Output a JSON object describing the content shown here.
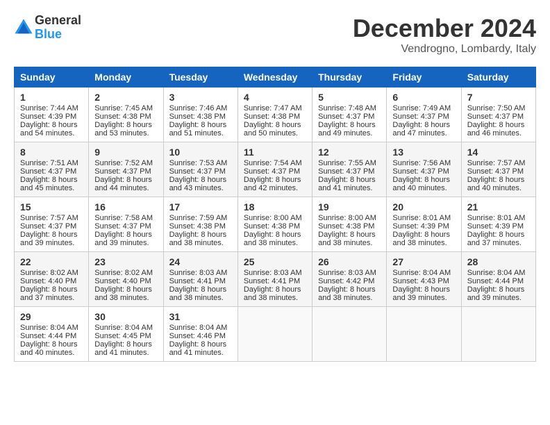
{
  "logo": {
    "general": "General",
    "blue": "Blue"
  },
  "title": "December 2024",
  "location": "Vendrogno, Lombardy, Italy",
  "days_of_week": [
    "Sunday",
    "Monday",
    "Tuesday",
    "Wednesday",
    "Thursday",
    "Friday",
    "Saturday"
  ],
  "weeks": [
    [
      {
        "day": "1",
        "sunrise": "Sunrise: 7:44 AM",
        "sunset": "Sunset: 4:39 PM",
        "daylight": "Daylight: 8 hours and 54 minutes."
      },
      {
        "day": "2",
        "sunrise": "Sunrise: 7:45 AM",
        "sunset": "Sunset: 4:38 PM",
        "daylight": "Daylight: 8 hours and 53 minutes."
      },
      {
        "day": "3",
        "sunrise": "Sunrise: 7:46 AM",
        "sunset": "Sunset: 4:38 PM",
        "daylight": "Daylight: 8 hours and 51 minutes."
      },
      {
        "day": "4",
        "sunrise": "Sunrise: 7:47 AM",
        "sunset": "Sunset: 4:38 PM",
        "daylight": "Daylight: 8 hours and 50 minutes."
      },
      {
        "day": "5",
        "sunrise": "Sunrise: 7:48 AM",
        "sunset": "Sunset: 4:37 PM",
        "daylight": "Daylight: 8 hours and 49 minutes."
      },
      {
        "day": "6",
        "sunrise": "Sunrise: 7:49 AM",
        "sunset": "Sunset: 4:37 PM",
        "daylight": "Daylight: 8 hours and 47 minutes."
      },
      {
        "day": "7",
        "sunrise": "Sunrise: 7:50 AM",
        "sunset": "Sunset: 4:37 PM",
        "daylight": "Daylight: 8 hours and 46 minutes."
      }
    ],
    [
      {
        "day": "8",
        "sunrise": "Sunrise: 7:51 AM",
        "sunset": "Sunset: 4:37 PM",
        "daylight": "Daylight: 8 hours and 45 minutes."
      },
      {
        "day": "9",
        "sunrise": "Sunrise: 7:52 AM",
        "sunset": "Sunset: 4:37 PM",
        "daylight": "Daylight: 8 hours and 44 minutes."
      },
      {
        "day": "10",
        "sunrise": "Sunrise: 7:53 AM",
        "sunset": "Sunset: 4:37 PM",
        "daylight": "Daylight: 8 hours and 43 minutes."
      },
      {
        "day": "11",
        "sunrise": "Sunrise: 7:54 AM",
        "sunset": "Sunset: 4:37 PM",
        "daylight": "Daylight: 8 hours and 42 minutes."
      },
      {
        "day": "12",
        "sunrise": "Sunrise: 7:55 AM",
        "sunset": "Sunset: 4:37 PM",
        "daylight": "Daylight: 8 hours and 41 minutes."
      },
      {
        "day": "13",
        "sunrise": "Sunrise: 7:56 AM",
        "sunset": "Sunset: 4:37 PM",
        "daylight": "Daylight: 8 hours and 40 minutes."
      },
      {
        "day": "14",
        "sunrise": "Sunrise: 7:57 AM",
        "sunset": "Sunset: 4:37 PM",
        "daylight": "Daylight: 8 hours and 40 minutes."
      }
    ],
    [
      {
        "day": "15",
        "sunrise": "Sunrise: 7:57 AM",
        "sunset": "Sunset: 4:37 PM",
        "daylight": "Daylight: 8 hours and 39 minutes."
      },
      {
        "day": "16",
        "sunrise": "Sunrise: 7:58 AM",
        "sunset": "Sunset: 4:37 PM",
        "daylight": "Daylight: 8 hours and 39 minutes."
      },
      {
        "day": "17",
        "sunrise": "Sunrise: 7:59 AM",
        "sunset": "Sunset: 4:38 PM",
        "daylight": "Daylight: 8 hours and 38 minutes."
      },
      {
        "day": "18",
        "sunrise": "Sunrise: 8:00 AM",
        "sunset": "Sunset: 4:38 PM",
        "daylight": "Daylight: 8 hours and 38 minutes."
      },
      {
        "day": "19",
        "sunrise": "Sunrise: 8:00 AM",
        "sunset": "Sunset: 4:38 PM",
        "daylight": "Daylight: 8 hours and 38 minutes."
      },
      {
        "day": "20",
        "sunrise": "Sunrise: 8:01 AM",
        "sunset": "Sunset: 4:39 PM",
        "daylight": "Daylight: 8 hours and 38 minutes."
      },
      {
        "day": "21",
        "sunrise": "Sunrise: 8:01 AM",
        "sunset": "Sunset: 4:39 PM",
        "daylight": "Daylight: 8 hours and 37 minutes."
      }
    ],
    [
      {
        "day": "22",
        "sunrise": "Sunrise: 8:02 AM",
        "sunset": "Sunset: 4:40 PM",
        "daylight": "Daylight: 8 hours and 37 minutes."
      },
      {
        "day": "23",
        "sunrise": "Sunrise: 8:02 AM",
        "sunset": "Sunset: 4:40 PM",
        "daylight": "Daylight: 8 hours and 38 minutes."
      },
      {
        "day": "24",
        "sunrise": "Sunrise: 8:03 AM",
        "sunset": "Sunset: 4:41 PM",
        "daylight": "Daylight: 8 hours and 38 minutes."
      },
      {
        "day": "25",
        "sunrise": "Sunrise: 8:03 AM",
        "sunset": "Sunset: 4:41 PM",
        "daylight": "Daylight: 8 hours and 38 minutes."
      },
      {
        "day": "26",
        "sunrise": "Sunrise: 8:03 AM",
        "sunset": "Sunset: 4:42 PM",
        "daylight": "Daylight: 8 hours and 38 minutes."
      },
      {
        "day": "27",
        "sunrise": "Sunrise: 8:04 AM",
        "sunset": "Sunset: 4:43 PM",
        "daylight": "Daylight: 8 hours and 39 minutes."
      },
      {
        "day": "28",
        "sunrise": "Sunrise: 8:04 AM",
        "sunset": "Sunset: 4:44 PM",
        "daylight": "Daylight: 8 hours and 39 minutes."
      }
    ],
    [
      {
        "day": "29",
        "sunrise": "Sunrise: 8:04 AM",
        "sunset": "Sunset: 4:44 PM",
        "daylight": "Daylight: 8 hours and 40 minutes."
      },
      {
        "day": "30",
        "sunrise": "Sunrise: 8:04 AM",
        "sunset": "Sunset: 4:45 PM",
        "daylight": "Daylight: 8 hours and 41 minutes."
      },
      {
        "day": "31",
        "sunrise": "Sunrise: 8:04 AM",
        "sunset": "Sunset: 4:46 PM",
        "daylight": "Daylight: 8 hours and 41 minutes."
      },
      null,
      null,
      null,
      null
    ]
  ]
}
